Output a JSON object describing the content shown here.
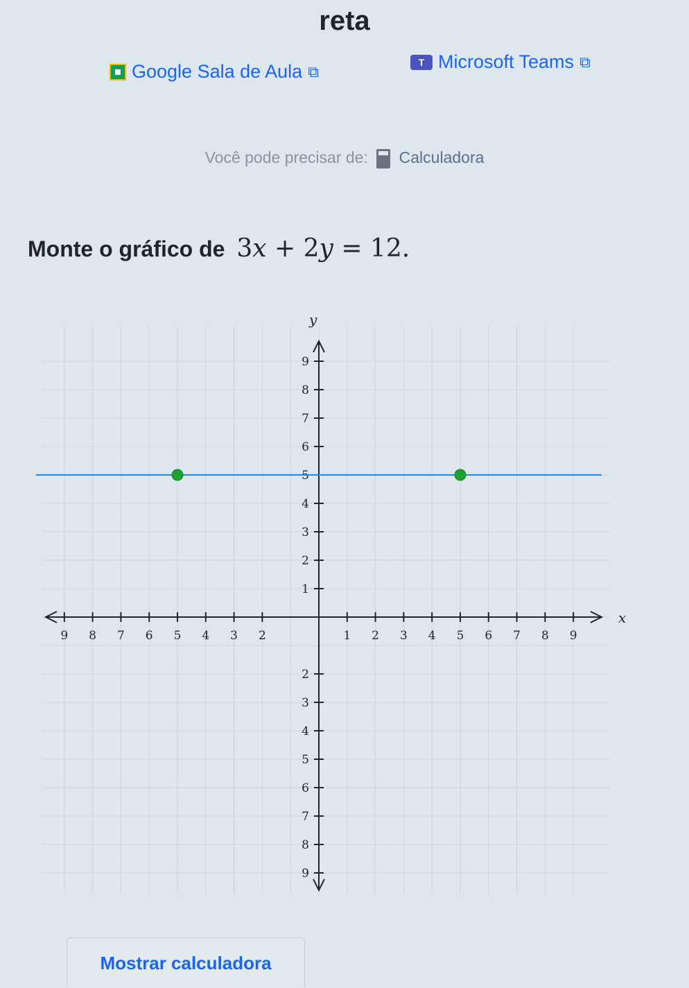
{
  "header": {
    "title": "reta"
  },
  "share": {
    "classroom_label": "Google Sala de Aula",
    "teams_label": "Microsoft Teams",
    "external_glyph": "⧉"
  },
  "tools": {
    "prefix": "Você pode precisar de:",
    "calculator_label": "Calculadora"
  },
  "question": {
    "prompt": "Monte o gráfico de",
    "equation_parts": [
      "3",
      "x",
      " + 2",
      "y",
      " = 12."
    ]
  },
  "chart_data": {
    "type": "line",
    "xlabel": "x",
    "ylabel": "y",
    "xlim": [
      -10,
      10
    ],
    "ylim": [
      -10,
      10
    ],
    "x_ticks": [
      -9,
      -8,
      -7,
      -6,
      -5,
      -4,
      -3,
      -2,
      1,
      2,
      3,
      4,
      5,
      6,
      7,
      8,
      9
    ],
    "x_tick_labels": [
      "9",
      "8",
      "7",
      "6",
      "5",
      "4",
      "3",
      "2",
      "1",
      "2",
      "3",
      "4",
      "5",
      "6",
      "7",
      "8",
      "9"
    ],
    "y_ticks": [
      1,
      2,
      3,
      4,
      5,
      6,
      7,
      8,
      9,
      -2,
      -3,
      -4,
      -5,
      -6,
      -7,
      -8,
      -9
    ],
    "y_tick_labels": [
      "1",
      "2",
      "3",
      "4",
      "5",
      "6",
      "7",
      "8",
      "9",
      "2",
      "3",
      "4",
      "5",
      "6",
      "7",
      "8",
      "9"
    ],
    "line": {
      "points": [
        [
          -10,
          5
        ],
        [
          10,
          5
        ]
      ],
      "color": "#1c8ae6"
    },
    "control_points": [
      {
        "x": -5,
        "y": 5
      },
      {
        "x": 5,
        "y": 5
      }
    ],
    "point_color": "#1fa12e",
    "grid": true
  },
  "footer": {
    "calculator_button": "Mostrar calculadora"
  },
  "colors": {
    "link": "#1865f2",
    "text": "#21242c",
    "background": "#dfe7ee"
  }
}
